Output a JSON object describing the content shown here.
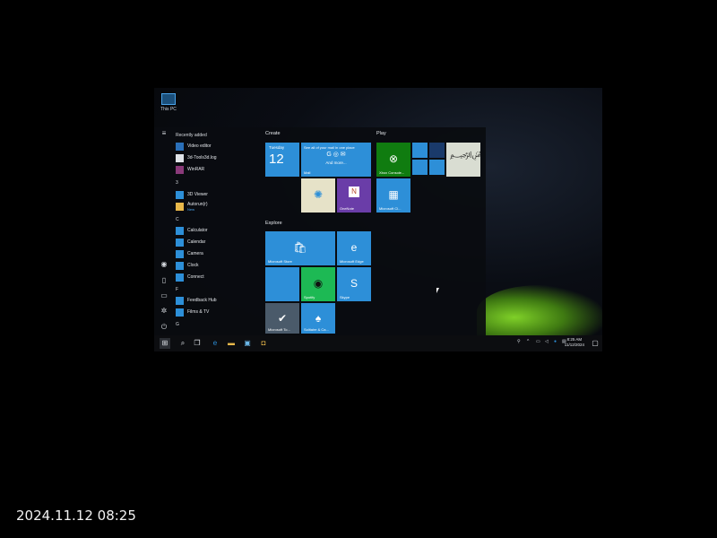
{
  "desktop": {
    "this_pc_label": "This PC"
  },
  "start_menu": {
    "recently_added_header": "Recently added",
    "recent": [
      "Video editor",
      "3d-Tools3d.log",
      "WinRAR"
    ],
    "letter_3": "3",
    "section_3": [
      {
        "label": "3D Viewer"
      },
      {
        "label": "Autorun(r)",
        "sub": "New"
      }
    ],
    "letter_c": "C",
    "section_c": [
      "Calculator",
      "Calendar",
      "Camera",
      "Clock",
      "Connect"
    ],
    "letter_f": "F",
    "section_f": [
      "Feedback Hub",
      "Films & TV"
    ],
    "letter_g": "G"
  },
  "tiles": {
    "create_label": "Create",
    "play_label": "Play",
    "explore_label": "Explore",
    "calendar_day": "Tuesday",
    "calendar_date": "12",
    "mail_top": "See all of your mail in one place",
    "mail_more": "And more...",
    "mail_label": "Mail",
    "onenote_label": "OneNote",
    "xbox_label": "Xbox Console...",
    "ms_clip_label": "Microsoft Cl...",
    "store_label": "Microsoft Store",
    "edge_label": "Microsoft Edge",
    "spotify_label": "Spotify",
    "skype_label": "Skype",
    "todo_label": "Microsoft To...",
    "solitaire_label": "Solitaire & Ca..."
  },
  "taskbar": {
    "clock_time": "8:25 AM",
    "clock_date": "11/12/2024"
  },
  "camera_timestamp": "2024.11.12 08:25",
  "colors": {
    "tile_blue": "#2d8fd8",
    "tile_purple": "#6a3da8",
    "xbox_green": "#107c10",
    "spotify_green": "#1db954"
  }
}
